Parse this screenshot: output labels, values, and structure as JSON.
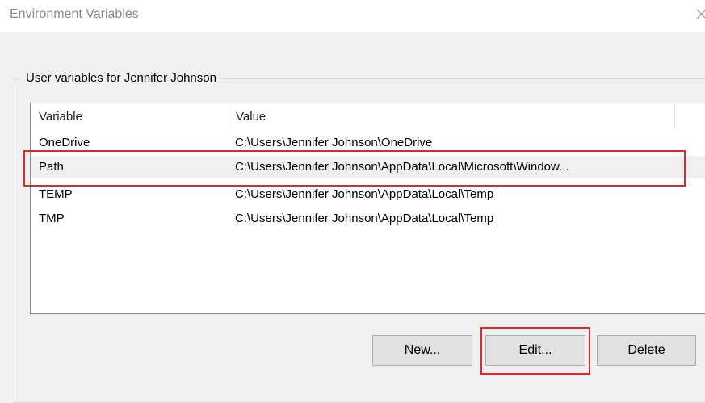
{
  "window": {
    "title": "Environment Variables"
  },
  "group": {
    "label": "User variables for Jennifer Johnson"
  },
  "table": {
    "columns": [
      "Variable",
      "Value"
    ],
    "rows": [
      {
        "variable": "OneDrive",
        "value": "C:\\Users\\Jennifer Johnson\\OneDrive"
      },
      {
        "variable": "Path",
        "value": "C:\\Users\\Jennifer Johnson\\AppData\\Local\\Microsoft\\Window..."
      },
      {
        "variable": "TEMP",
        "value": "C:\\Users\\Jennifer Johnson\\AppData\\Local\\Temp"
      },
      {
        "variable": "TMP",
        "value": "C:\\Users\\Jennifer Johnson\\AppData\\Local\\Temp"
      }
    ],
    "selected_row": "Path"
  },
  "buttons": {
    "new_label": "New...",
    "edit_label": "Edit...",
    "delete_label": "Delete"
  },
  "colors": {
    "highlight_outline": "#d92b2b",
    "selected_row_bg": "#f0f0f0",
    "window_bg": "#f0f0f0"
  }
}
